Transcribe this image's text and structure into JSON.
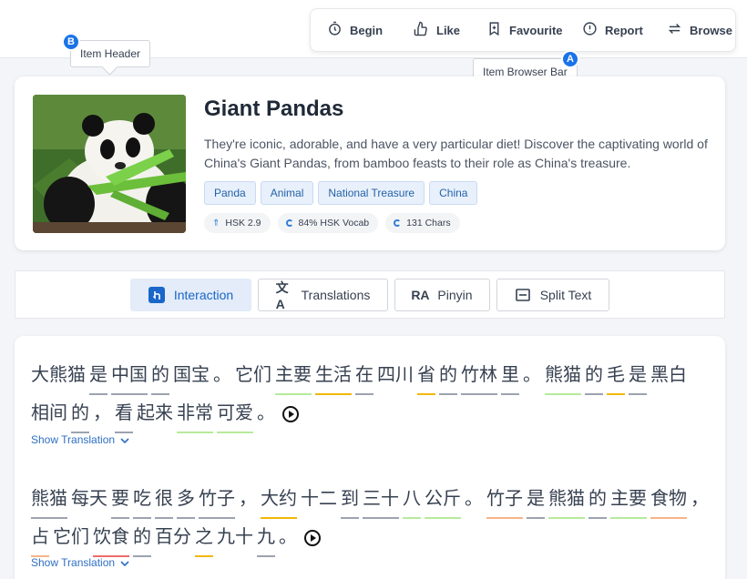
{
  "toolbar": {
    "items": [
      {
        "label": "Begin",
        "icon": "timer-icon"
      },
      {
        "label": "Like",
        "icon": "thumbs-up-icon"
      },
      {
        "label": "Favourite",
        "icon": "bookmark-icon"
      },
      {
        "label": "Report",
        "icon": "alert-circle-icon"
      },
      {
        "label": "Browse",
        "icon": "swap-arrows-icon"
      }
    ],
    "tooltip": "Item Browser Bar",
    "badge": "A"
  },
  "header_tooltip": {
    "label": "Item Header",
    "badge": "B"
  },
  "item": {
    "title": "Giant Pandas",
    "description": "They're iconic, adorable, and have a very particular diet! Discover the captivating world of China's Giant Pandas, from bamboo feasts to their role as China's treasure.",
    "tags": [
      "Panda",
      "Animal",
      "National Treasure",
      "China"
    ],
    "stats": [
      "HSK 2.9",
      "84% HSK Vocab",
      "131 Chars"
    ]
  },
  "tabs": [
    {
      "label": "Interaction",
      "active": true,
      "icon": "touch-icon"
    },
    {
      "label": "Translations",
      "active": false,
      "icon": "translate-icon"
    },
    {
      "label": "Pinyin",
      "active": false,
      "icon": "pinyin-icon"
    },
    {
      "label": "Split Text",
      "active": false,
      "icon": "split-text-icon"
    }
  ],
  "paragraphs": [
    {
      "words": [
        [
          "大熊猫",
          "none"
        ],
        [
          "是",
          "gray"
        ],
        [
          "中国",
          "gray"
        ],
        [
          "的",
          "gray"
        ],
        [
          "国宝",
          "none"
        ],
        [
          "。",
          "none"
        ],
        [
          "它们",
          "none"
        ],
        [
          "主要",
          "green"
        ],
        [
          "生活",
          "yellow"
        ],
        [
          "在",
          "gray"
        ],
        [
          "四川",
          "none"
        ],
        [
          "省",
          "yellow"
        ],
        [
          "的",
          "gray"
        ],
        [
          "竹林",
          "gray"
        ],
        [
          "里",
          "gray"
        ],
        [
          "。",
          "none"
        ],
        [
          "熊猫",
          "green"
        ],
        [
          "的",
          "gray"
        ],
        [
          "毛",
          "yellow"
        ],
        [
          "是",
          "gray"
        ],
        [
          "黑白",
          "none"
        ],
        [
          "相间",
          "none"
        ],
        [
          "的",
          "gray"
        ],
        [
          "，",
          "none"
        ],
        [
          "看",
          "gray"
        ],
        [
          "起来",
          "none"
        ],
        [
          "非常",
          "green"
        ],
        [
          "可爱",
          "green"
        ],
        [
          "。",
          "none"
        ]
      ],
      "show_translation": "Show Translation"
    },
    {
      "words": [
        [
          "熊猫",
          "gray"
        ],
        [
          "每天",
          "none"
        ],
        [
          "要",
          "gray"
        ],
        [
          "吃",
          "gray"
        ],
        [
          "很",
          "gray"
        ],
        [
          "多",
          "gray"
        ],
        [
          "竹子",
          "gray"
        ],
        [
          "，",
          "none"
        ],
        [
          "大约",
          "yellow"
        ],
        [
          "十二",
          "none"
        ],
        [
          "到",
          "gray"
        ],
        [
          "三十",
          "gray"
        ],
        [
          "八",
          "green"
        ],
        [
          "公斤",
          "green"
        ],
        [
          "。",
          "none"
        ],
        [
          "竹子",
          "orange"
        ],
        [
          "是",
          "gray"
        ],
        [
          "熊猫",
          "green"
        ],
        [
          "的",
          "gray"
        ],
        [
          "主要",
          "green"
        ],
        [
          "食物",
          "orange"
        ],
        [
          "，",
          "none"
        ],
        [
          "占",
          "orange"
        ],
        [
          "它们",
          "none"
        ],
        [
          "饮食",
          "red"
        ],
        [
          "的",
          "gray"
        ],
        [
          "百分",
          "none"
        ],
        [
          "之",
          "yellow"
        ],
        [
          "九十",
          "none"
        ],
        [
          "九",
          "gray"
        ],
        [
          "。",
          "none"
        ]
      ],
      "show_translation": "Show Translation"
    }
  ]
}
